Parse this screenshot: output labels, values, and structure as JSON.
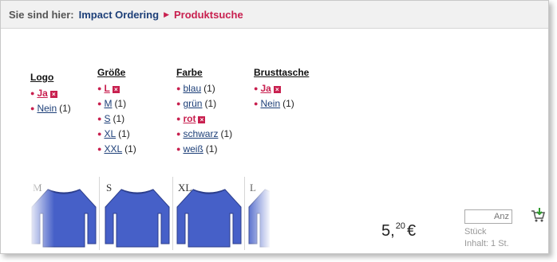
{
  "breadcrumb": {
    "label": "Sie sind hier:",
    "link": "Impact Ordering",
    "separator_icon": "triangle-right",
    "current": "Produktsuche"
  },
  "facets": [
    {
      "title": "Logo",
      "values": [
        {
          "label": "Ja",
          "count": "",
          "active": true
        },
        {
          "label": "Nein",
          "count": "(1)",
          "active": false
        }
      ]
    },
    {
      "title": "Größe",
      "values": [
        {
          "label": "L",
          "count": "",
          "active": true
        },
        {
          "label": "M",
          "count": "(1)",
          "active": false
        },
        {
          "label": "S",
          "count": "(1)",
          "active": false
        },
        {
          "label": "XL",
          "count": "(1)",
          "active": false
        },
        {
          "label": "XXL",
          "count": "(1)",
          "active": false
        }
      ]
    },
    {
      "title": "Farbe",
      "values": [
        {
          "label": "blau",
          "count": "(1)",
          "active": false
        },
        {
          "label": "grün",
          "count": "(1)",
          "active": false
        },
        {
          "label": "rot",
          "count": "",
          "active": true
        },
        {
          "label": "schwarz",
          "count": "(1)",
          "active": false
        },
        {
          "label": "weiß",
          "count": "(1)",
          "active": false
        }
      ]
    },
    {
      "title": "Brusttasche",
      "values": [
        {
          "label": "Ja",
          "count": "",
          "active": true
        },
        {
          "label": "Nein",
          "count": "(1)",
          "active": false
        }
      ]
    }
  ],
  "thumbnails": [
    "M",
    "S",
    "XL",
    "L"
  ],
  "price": {
    "whole": "5,",
    "cents": "20",
    "currency": "€"
  },
  "quantity": {
    "placeholder": "Anz",
    "unit": "Stück",
    "content": "Inhalt: 1 St."
  },
  "colors": {
    "accent": "#c8204f",
    "link": "#1d3f78",
    "shirt": "#4660c8"
  },
  "icons": {
    "remove": "remove-filter-icon",
    "cart": "add-to-cart-icon"
  }
}
